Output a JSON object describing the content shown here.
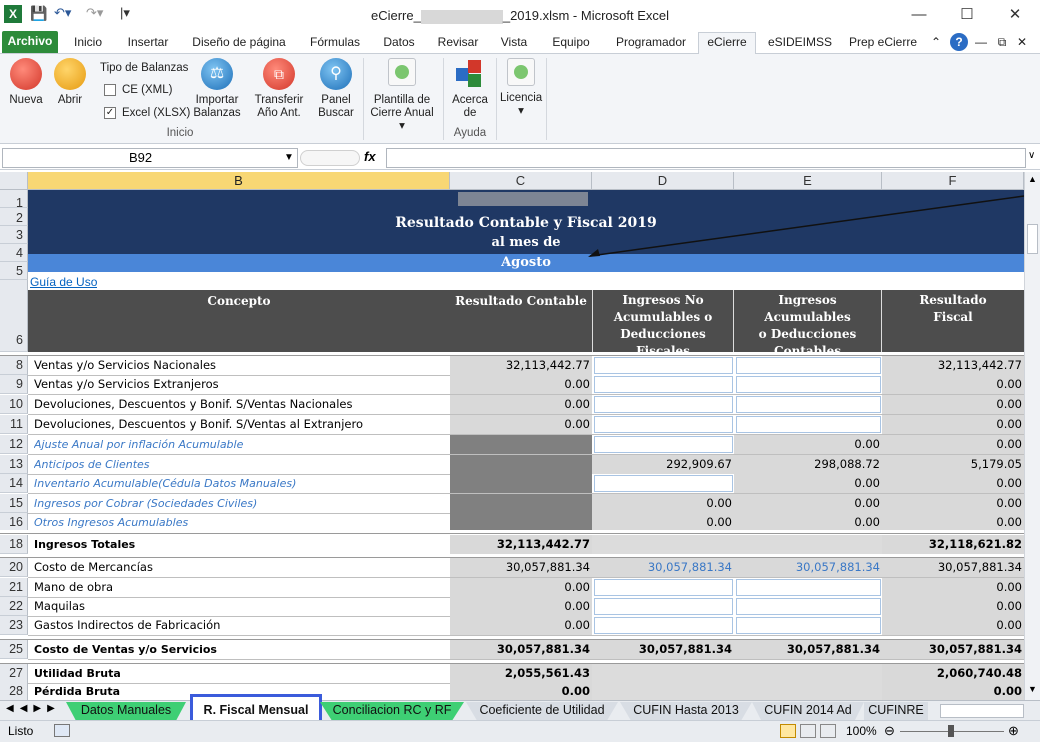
{
  "window": {
    "title_prefix": "eCierre_",
    "title_suffix": "_2019.xlsm - Microsoft Excel"
  },
  "ribbon_tabs": [
    "Archivo",
    "Inicio",
    "Insertar",
    "Diseño de página",
    "Fórmulas",
    "Datos",
    "Revisar",
    "Vista",
    "Equipo",
    "Programador",
    "eCierre",
    "eSIDEIMSS",
    "Prep eCierre"
  ],
  "ribbon": {
    "nueva": "Nueva",
    "abrir": "Abrir",
    "tipo_balanzas": "Tipo de Balanzas",
    "ce_xml": "CE (XML)",
    "excel_xlsx": "Excel (XLSX)",
    "importar": [
      "Importar",
      "Balanzas"
    ],
    "transferir": [
      "Transferir",
      "Año Ant."
    ],
    "panel": [
      "Panel",
      "Buscar"
    ],
    "plantilla": [
      "Plantilla de",
      "Cierre Anual"
    ],
    "acerca": [
      "Acerca",
      "de"
    ],
    "licencia": "Licencia",
    "group_inicio": "Inicio",
    "group_ayuda": "Ayuda"
  },
  "formula": {
    "name_box": "B92",
    "fx": "fx"
  },
  "columns": [
    "B",
    "C",
    "D",
    "E",
    "F"
  ],
  "sheet": {
    "title1": "Resultado Contable y Fiscal 2019",
    "title2": "al mes de",
    "month": "Agosto",
    "guide_link": "Guía de Uso",
    "headers": {
      "concepto": "Concepto",
      "rc": "Resultado Contable",
      "ing_no": [
        "Ingresos No",
        "Acumulables o",
        "Deducciones Fiscales"
      ],
      "ing_ac": [
        "Ingresos  Acumulables",
        "o Deducciones",
        "Contables"
      ],
      "rf": [
        "Resultado",
        "Fiscal"
      ]
    },
    "rows": [
      {
        "n": "8",
        "label": "Ventas y/o Servicios Nacionales",
        "c": "32,113,442.77",
        "d": "",
        "e": "",
        "f": "32,113,442.77",
        "style": "normal"
      },
      {
        "n": "9",
        "label": "Ventas y/o Servicios Extranjeros",
        "c": "0.00",
        "d": "",
        "e": "",
        "f": "0.00",
        "style": "normal"
      },
      {
        "n": "10",
        "label": "Devoluciones, Descuentos y Bonif. S/Ventas Nacionales",
        "c": "0.00",
        "d": "",
        "e": "",
        "f": "0.00",
        "style": "normal"
      },
      {
        "n": "11",
        "label": "Devoluciones, Descuentos y Bonif. S/Ventas al Extranjero",
        "c": "0.00",
        "d": "",
        "e": "",
        "f": "0.00",
        "style": "normal"
      },
      {
        "n": "12",
        "label": "Ajuste Anual por inflación Acumulable",
        "c": "",
        "d": "",
        "e": "0.00",
        "f": "0.00",
        "style": "italic"
      },
      {
        "n": "13",
        "label": "Anticipos de Clientes",
        "c": "",
        "d": "292,909.67",
        "e": "298,088.72",
        "f": "5,179.05",
        "style": "italic"
      },
      {
        "n": "14",
        "label": "Inventario Acumulable(Cédula Datos Manuales)",
        "c": "",
        "d": "",
        "e": "0.00",
        "f": "0.00",
        "style": "italic"
      },
      {
        "n": "15",
        "label": "Ingresos por Cobrar (Sociedades Civiles)",
        "c": "",
        "d": "0.00",
        "e": "0.00",
        "f": "0.00",
        "style": "italic"
      },
      {
        "n": "16",
        "label": "Otros Ingresos Acumulables",
        "c": "",
        "d": "0.00",
        "e": "0.00",
        "f": "0.00",
        "style": "italic"
      },
      {
        "n": "18",
        "label": "Ingresos Totales",
        "c": "32,113,442.77",
        "d": "",
        "e": "",
        "f": "32,118,621.82",
        "style": "bold"
      },
      {
        "n": "20",
        "label": "Costo de Mercancías",
        "c": "30,057,881.34",
        "d": "30,057,881.34",
        "e": "30,057,881.34",
        "f": "30,057,881.34",
        "style": "normal"
      },
      {
        "n": "21",
        "label": "Mano de obra",
        "c": "0.00",
        "d": "",
        "e": "",
        "f": "0.00",
        "style": "normal"
      },
      {
        "n": "22",
        "label": "Maquilas",
        "c": "0.00",
        "d": "",
        "e": "",
        "f": "0.00",
        "style": "normal"
      },
      {
        "n": "23",
        "label": "Gastos Indirectos de Fabricación",
        "c": "0.00",
        "d": "",
        "e": "",
        "f": "0.00",
        "style": "normal"
      },
      {
        "n": "25",
        "label": "Costo de Ventas y/o Servicios",
        "c": "30,057,881.34",
        "d": "30,057,881.34",
        "e": "30,057,881.34",
        "f": "30,057,881.34",
        "style": "bold"
      },
      {
        "n": "27",
        "label": "Utilidad Bruta",
        "c": "2,055,561.43",
        "d": "",
        "e": "",
        "f": "2,060,740.48",
        "style": "bold"
      },
      {
        "n": "28",
        "label": "Pérdida Bruta",
        "c": "0.00",
        "d": "",
        "e": "",
        "f": "0.00",
        "style": "bold"
      }
    ]
  },
  "sheet_tabs": [
    "Datos Manuales",
    "R. Fiscal Mensual",
    "Conciliacion RC y RF",
    "Coeficiente de Utilidad",
    "CUFIN Hasta 2013",
    "CUFIN 2014 Ad",
    "CUFINRE"
  ],
  "status": {
    "ready": "Listo",
    "zoom": "100%"
  },
  "colors": {
    "navy": "#1f3864",
    "blue": "#4a86d8",
    "header_gray": "#4d4d4d",
    "cell_gray": "#d9d9d9",
    "dark_gray": "#808080",
    "link": "#0563c1"
  }
}
